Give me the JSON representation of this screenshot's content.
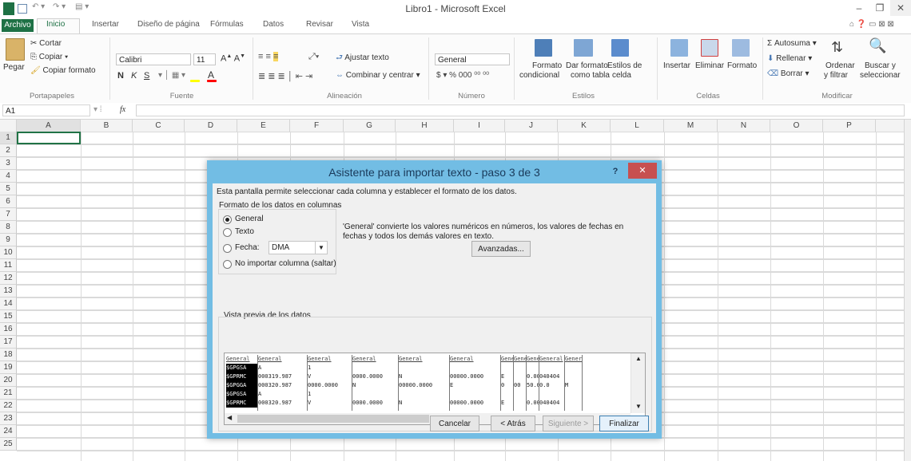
{
  "window": {
    "title": "Libro1  -  Microsoft Excel",
    "minimize": "–",
    "restore": "❐",
    "close": "✕"
  },
  "tabs": [
    "Archivo",
    "Inicio",
    "Insertar",
    "Diseño de página",
    "Fórmulas",
    "Datos",
    "Revisar",
    "Vista"
  ],
  "ribbon": {
    "portapapeles": {
      "pegar": "Pegar",
      "cortar": "Cortar",
      "copiar": "Copiar",
      "copiar_formato": "Copiar formato",
      "label": "Portapapeles"
    },
    "fuente": {
      "font": "Calibri",
      "size": "11",
      "bold": "N",
      "italic": "K",
      "underline": "S",
      "label": "Fuente"
    },
    "alineacion": {
      "ajustar": "Ajustar texto",
      "combinar": "Combinar y centrar",
      "label": "Alineación"
    },
    "numero": {
      "format": "General",
      "label": "Número"
    },
    "estilos": {
      "formato_cond": "Formato",
      "formato_cond2": "condicional",
      "dar_formato": "Dar formato",
      "dar_formato2": "como tabla",
      "estilos_celda": "Estilos de",
      "estilos_celda2": "celda",
      "label": "Estilos"
    },
    "celdas": {
      "insertar": "Insertar",
      "eliminar": "Eliminar",
      "formato": "Formato",
      "label": "Celdas"
    },
    "modificar": {
      "autosuma": "Autosuma",
      "rellenar": "Rellenar",
      "borrar": "Borrar",
      "ordenar": "Ordenar",
      "ordenar2": "y filtrar",
      "buscar": "Buscar y",
      "buscar2": "seleccionar",
      "label": "Modificar"
    }
  },
  "formula_bar": {
    "name_box": "A1",
    "fx": "fx",
    "value": ""
  },
  "columns": [
    "A",
    "B",
    "C",
    "D",
    "E",
    "F",
    "G",
    "H",
    "I",
    "J",
    "K",
    "L",
    "M",
    "N",
    "O",
    "P"
  ],
  "rows": [
    "1",
    "2",
    "3",
    "4",
    "5",
    "6",
    "7",
    "8",
    "9",
    "10",
    "11",
    "12",
    "13",
    "14",
    "15",
    "16",
    "17",
    "18",
    "19",
    "20",
    "21",
    "22",
    "23",
    "24",
    "25"
  ],
  "dialog": {
    "title": "Asistente para importar texto - paso 3 de 3",
    "help": "?",
    "close": "✕",
    "intro": "Esta pantalla permite seleccionar cada columna y establecer el formato de los datos.",
    "format_group": "Formato de los datos en columnas",
    "options": [
      "General",
      "Texto",
      "Fecha:",
      "No importar columna (saltar)"
    ],
    "selected_option": "General",
    "date_format": "DMA",
    "description": "'General' convierte los valores numéricos en números, los valores de fechas en fechas y todos los demás valores en texto.",
    "advanced": "Avanzadas...",
    "preview_label": "Vista previa de los datos",
    "preview_headers": [
      "General",
      "General",
      "General",
      "General",
      "General",
      "General",
      "Gener",
      "Gener",
      "Gener",
      "General",
      "Genera"
    ],
    "preview_rows": [
      [
        "$GPGSA",
        "A",
        "1",
        "",
        "",
        "",
        "",
        "",
        "",
        "",
        ""
      ],
      [
        "$GPRMC",
        "000319.987",
        "V",
        "0000.0000",
        "N",
        "00000.0000",
        "E",
        "",
        "0.00",
        "040404",
        ""
      ],
      [
        "$GPGGA",
        "000320.987",
        "0000.0000",
        "N",
        "00000.0000",
        "E",
        "0",
        "00",
        "50.0",
        "0.0",
        "M"
      ],
      [
        "$GPGSA",
        "A",
        "1",
        "",
        "",
        "",
        "",
        "",
        "",
        "",
        ""
      ],
      [
        "$GPRMC",
        "000320.987",
        "V",
        "0000.0000",
        "N",
        "00000.0000",
        "E",
        "",
        "0.00",
        "040404",
        ""
      ]
    ],
    "buttons": {
      "cancel": "Cancelar",
      "back": "< Atrás",
      "next": "Siguiente >",
      "finish": "Finalizar"
    }
  }
}
